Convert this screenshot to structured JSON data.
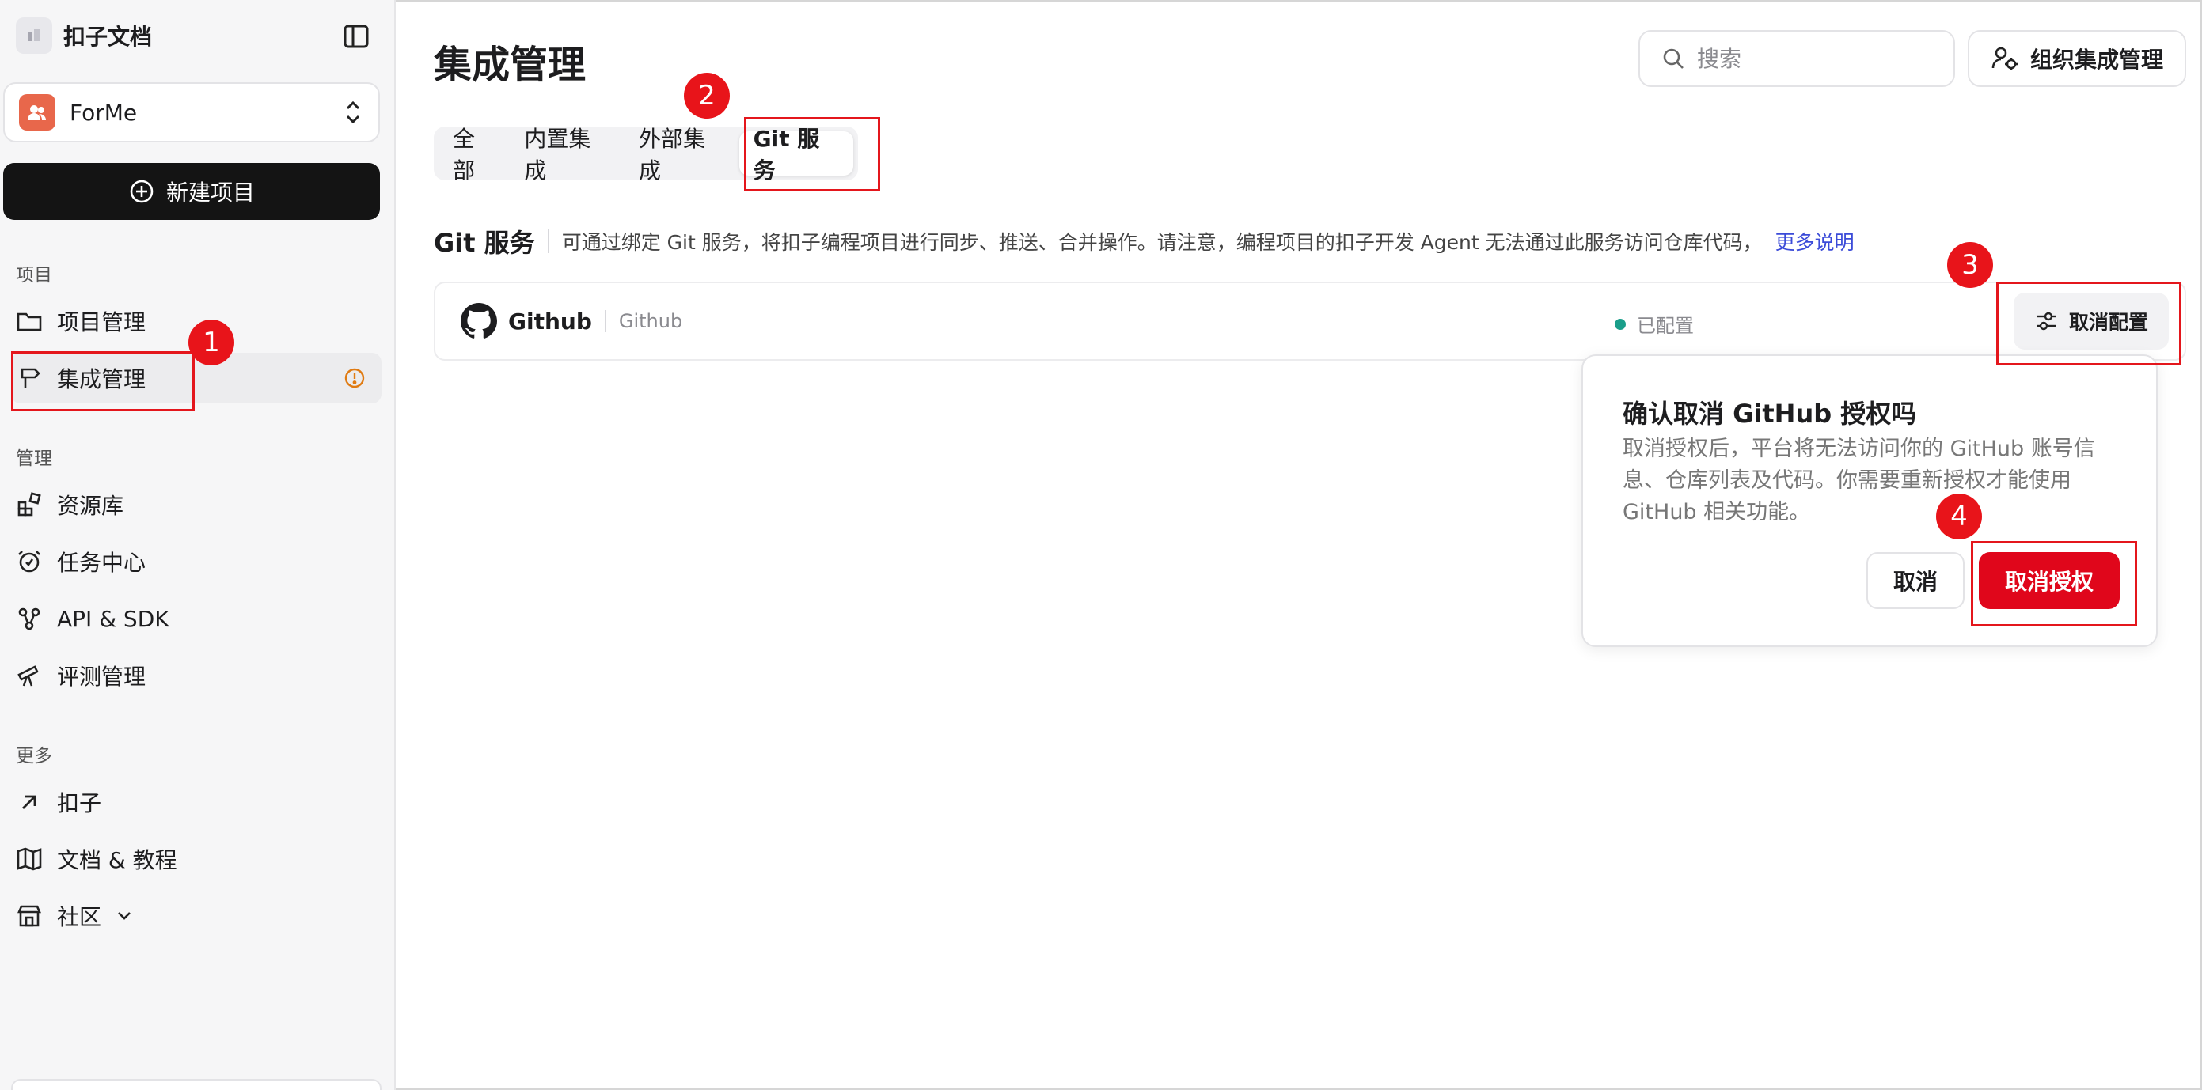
{
  "app": {
    "name": "扣子文档"
  },
  "workspace": {
    "name": "ForMe"
  },
  "sidebar": {
    "new_project": "新建项目",
    "sections": {
      "project": "项目",
      "manage": "管理",
      "more": "更多"
    },
    "items": {
      "project_mgmt": "项目管理",
      "integration_mgmt": "集成管理",
      "resources": "资源库",
      "tasks": "任务中心",
      "api_sdk": "API & SDK",
      "evaluation": "评测管理",
      "kouzi": "扣子",
      "docs": "文档 & 教程",
      "community": "社区"
    }
  },
  "header": {
    "title": "集成管理",
    "search_placeholder": "搜索",
    "org_button": "组织集成管理"
  },
  "tabs": [
    "全部",
    "内置集成",
    "外部集成",
    "Git 服务"
  ],
  "git_section": {
    "title": "Git 服务",
    "description": "可通过绑定 Git 服务，将扣子编程项目进行同步、推送、合并操作。请注意，编程项目的扣子开发 Agent 无法通过此服务访问仓库代码，",
    "link": "更多说明"
  },
  "integration": {
    "name": "Github",
    "subtitle": "Github",
    "status": "已配置",
    "unconfigure_button": "取消配置",
    "status_color": "#1a9e8a"
  },
  "popover": {
    "title": "确认取消 GitHub 授权吗",
    "body": "取消授权后，平台将无法访问你的 GitHub 账号信息、仓库列表及代码。你需要重新授权才能使用 GitHub 相关功能。",
    "cancel": "取消",
    "confirm": "取消授权",
    "confirm_color": "#e0061b"
  },
  "annotations": {
    "step1": "1",
    "step2": "2",
    "step3": "3",
    "step4": "4",
    "color": "#e4161c"
  }
}
